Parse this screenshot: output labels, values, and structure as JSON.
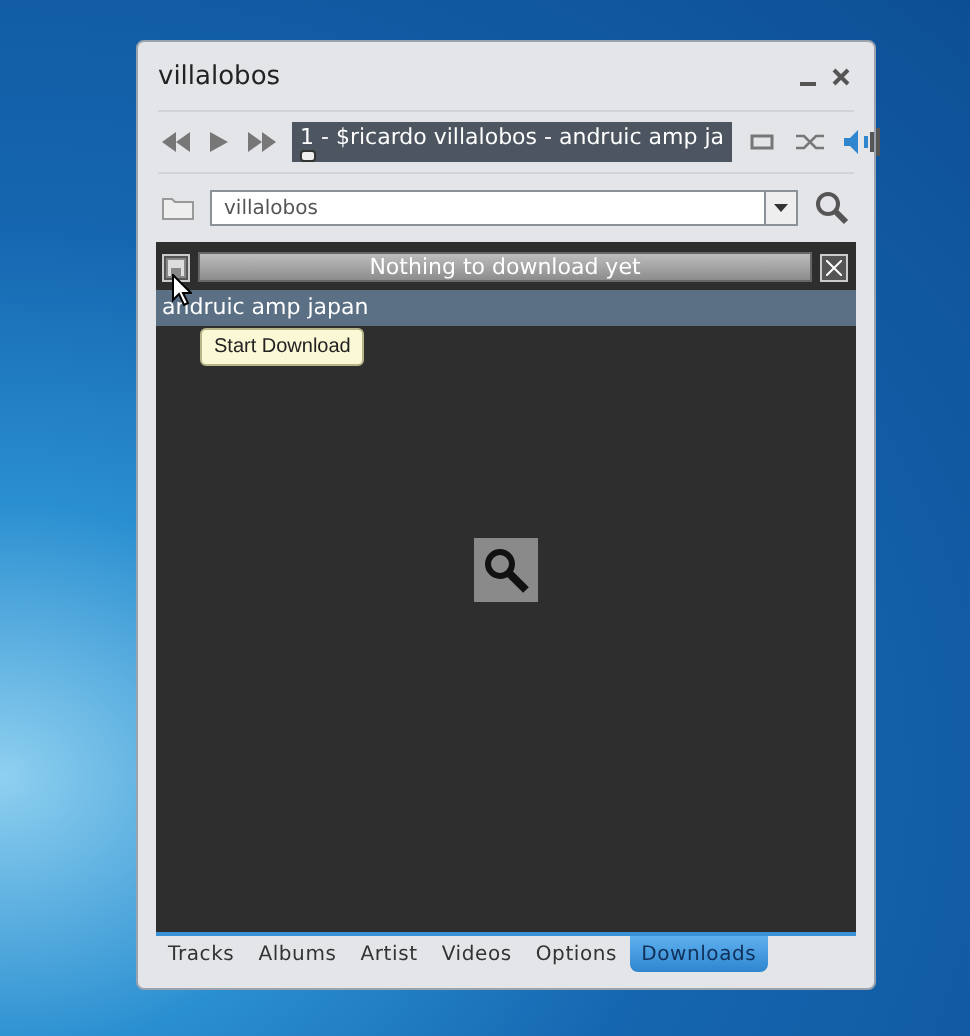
{
  "window": {
    "title": "villalobos"
  },
  "player": {
    "track": "1 - $ricardo villalobos - andruic amp ja",
    "progress": {
      "level": 0
    }
  },
  "search": {
    "value": "villalobos"
  },
  "downloads": {
    "status": "Nothing to download yet",
    "tooltip": "Start Download",
    "items": [
      {
        "title": "andruic amp japan",
        "selected": true
      }
    ]
  },
  "tabs": [
    {
      "label": "Tracks",
      "selected": false
    },
    {
      "label": "Albums",
      "selected": false
    },
    {
      "label": "Artist",
      "selected": false
    },
    {
      "label": "Videos",
      "selected": false
    },
    {
      "label": "Options",
      "selected": false
    },
    {
      "label": "Downloads",
      "selected": true
    }
  ]
}
